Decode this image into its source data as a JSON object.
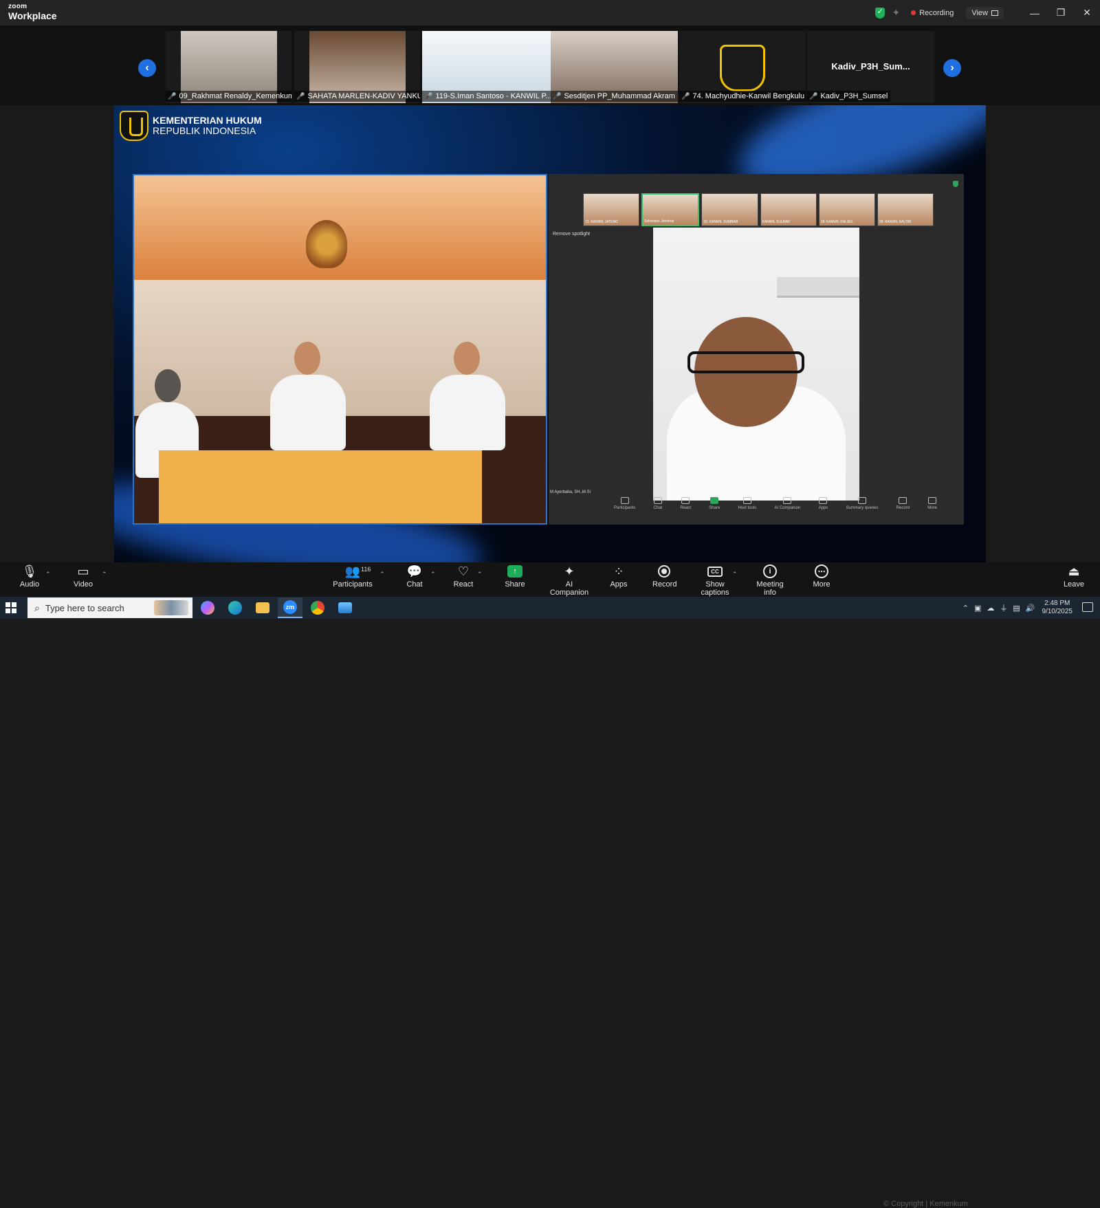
{
  "window": {
    "brand_small": "zoom",
    "brand_large": "Workplace",
    "recording_label": "Recording",
    "view_label": "View",
    "controls": {
      "minimize": "—",
      "restore": "❐",
      "close": "✕"
    }
  },
  "gallery": {
    "prev_arrow": "‹",
    "next_arrow": "›",
    "tiles": [
      {
        "label": "09_Rakhmat Renaldy_Kemenkum..."
      },
      {
        "label": "SAHATA MARLEN-KADIV YANKU..."
      },
      {
        "label": "119-S.Iman Santoso - KANWIL P..."
      },
      {
        "label": "Sesditjen PP_Muhammad Akram"
      },
      {
        "label": "74. Machyudhie-Kanwil Bengkulu"
      },
      {
        "label": "Kadiv_P3H_Sumsel",
        "big_name": "Kadiv_P3H_Sum..."
      }
    ]
  },
  "shared_screen": {
    "org_line1": "KEMENTERIAN HUKUM",
    "org_line2": "REPUBLIK INDONESIA",
    "inner_mini_tiles": [
      "72. KANWIL JATENG",
      "Sekretaris Jenderal",
      "33. KANWIL SUMBAR",
      "KANWIL SULBAR",
      "18. KANWIL KALSEL",
      "28. KANWIL KALTIM"
    ],
    "spotlight_label": "Remove spotlight",
    "speaker_name": "M Ayerbaba, SH.,M.Si",
    "inner_toolbar": [
      "Participants",
      "Chat",
      "React",
      "Share",
      "Host tools",
      "AI Companion",
      "Apps",
      "Summary queries",
      "Record",
      "More"
    ]
  },
  "toolbar": {
    "audio": "Audio",
    "video": "Video",
    "participants": "Participants",
    "participants_count": "116",
    "chat": "Chat",
    "react": "React",
    "share": "Share",
    "ai_companion": "AI Companion",
    "apps": "Apps",
    "record": "Record",
    "captions": "Show captions",
    "meeting_info": "Meeting info",
    "more": "More",
    "leave": "Leave"
  },
  "taskbar": {
    "search_placeholder": "Type here to search",
    "time": "2:48 PM",
    "date": "9/10/2025",
    "watermark": "© Copyright | Kemenkum"
  },
  "colors": {
    "accent_blue": "#1f6fe0",
    "share_green": "#1fad5c",
    "record_red": "#e8383d"
  }
}
